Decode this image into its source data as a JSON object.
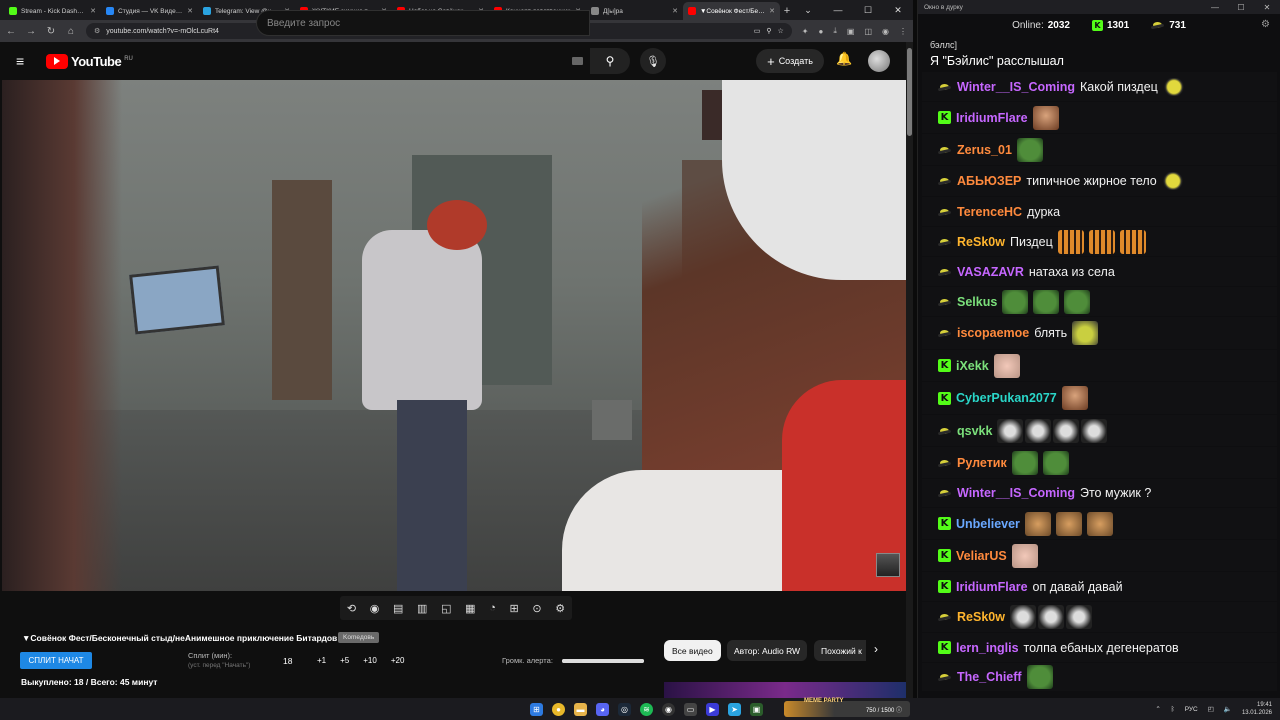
{
  "browser": {
    "tabs": [
      {
        "label": "Stream - Kick Dashboard",
        "color": "#53fc18"
      },
      {
        "label": "Студия — VK Видео Live",
        "color": "#2787f5"
      },
      {
        "label": "Telegram: View @union",
        "color": "#2aa3e0"
      },
      {
        "label": "ЖУТКИЕ зимние тради",
        "color": "#ff0000"
      },
      {
        "label": "Набег на Совёнок Фест",
        "color": "#ff0000"
      },
      {
        "label": "Концерт девственник",
        "color": "#ff0000"
      },
      {
        "label": "Д[ы]ра",
        "color": "#888888"
      },
      {
        "label": "▼Совёнок Фест/Беско",
        "color": "#ff0000"
      }
    ],
    "active_tab_index": 7,
    "url": "youtube.com/watch?v=-mOlcLcuRt4"
  },
  "youtube": {
    "logo_text": "YouTube",
    "logo_region": "RU",
    "search_placeholder": "Введите запрос",
    "create_label": "Создать"
  },
  "video": {
    "title": "▼Совёнок Фест/Бесконечный стыд/неАнимешное приключение Битардов",
    "category_badge": "Komeдoвь",
    "split_button": "СПЛИТ НАЧАТ",
    "split_label": "Сплит (мин):",
    "split_hint": "(уст. перед \"Начать\")",
    "split_value": "18",
    "split_steps": [
      "+1",
      "+5",
      "+10",
      "+20"
    ],
    "alert_volume_label": "Громк. алерта:",
    "alert_volume_level": 1.0,
    "bought_line": "Выкуплено: 18 / Всего: 45 минут",
    "chips": [
      "Все видео",
      "Автор: Audio RW",
      "Похожий к"
    ]
  },
  "chat": {
    "window_title": "Окно в дурку",
    "online_label": "Online:",
    "online_count": "2032",
    "kick_count": "1301",
    "vk_count": "731",
    "pre_lines": [
      "бэллс]",
      "Я \"Бэйлис\" расслышал"
    ],
    "messages": [
      {
        "platform": "owl",
        "user": "Winter__IS_Coming",
        "color": "#c667ff",
        "text": "Какой пиздец",
        "emotes": [
          "owl"
        ]
      },
      {
        "platform": "kick",
        "user": "IridiumFlare",
        "color": "#c667ff",
        "text": "",
        "emotes": [
          "face"
        ]
      },
      {
        "platform": "owl",
        "user": "Zerus_01",
        "color": "#ff8a3d",
        "text": "",
        "emotes": [
          "frog"
        ]
      },
      {
        "platform": "owl",
        "user": "АБЬЮЗЕР",
        "color": "#ff8a3d",
        "text": "типичное жирное тело",
        "emotes": [
          "owl"
        ]
      },
      {
        "platform": "owl",
        "user": "TerenceHC",
        "color": "#ff8a3d",
        "text": "дурка",
        "emotes": []
      },
      {
        "platform": "owl",
        "user": "ReSk0w",
        "color": "#ffb52e",
        "text": "Пиздец",
        "emotes": [
          "tiger",
          "tiger",
          "tiger"
        ]
      },
      {
        "platform": "owl",
        "user": "VASAZAVR",
        "color": "#c667ff",
        "text": "натаха из села",
        "emotes": []
      },
      {
        "platform": "owl",
        "user": "Selkus",
        "color": "#7be07b",
        "text": "",
        "emotes": [
          "frog",
          "frog",
          "frog"
        ]
      },
      {
        "platform": "owl",
        "user": "iscopaemoe",
        "color": "#ff8a3d",
        "text": "блять",
        "emotes": [
          "pepe"
        ]
      },
      {
        "platform": "kick",
        "user": "iXekk",
        "color": "#7be07b",
        "text": "",
        "emotes": [
          "cat"
        ]
      },
      {
        "platform": "kick",
        "user": "CyberPukan2077",
        "color": "#2ad6c8",
        "text": "",
        "emotes": [
          "face"
        ]
      },
      {
        "platform": "owl",
        "user": "qsvkk",
        "color": "#7be07b",
        "text": "",
        "emotes": [
          "skull",
          "skull",
          "skull",
          "skull"
        ]
      },
      {
        "platform": "owl",
        "user": "Рулетик",
        "color": "#ff8a3d",
        "text": "",
        "emotes": [
          "frog",
          "frog"
        ]
      },
      {
        "platform": "owl",
        "user": "Winter__IS_Coming",
        "color": "#c667ff",
        "text": "Это мужик ?",
        "emotes": []
      },
      {
        "platform": "kick",
        "user": "Unbeliever",
        "color": "#6aa8ff",
        "text": "",
        "emotes": [
          "lynx",
          "lynx",
          "lynx"
        ]
      },
      {
        "platform": "kick",
        "user": "VeliarUS",
        "color": "#ff8a3d",
        "text": "",
        "emotes": [
          "cat"
        ]
      },
      {
        "platform": "kick",
        "user": "IridiumFlare",
        "color": "#c667ff",
        "text": "оп давай давай",
        "emotes": []
      },
      {
        "platform": "owl",
        "user": "ReSk0w",
        "color": "#ffb52e",
        "text": "",
        "emotes": [
          "skull",
          "skull",
          "skull"
        ]
      },
      {
        "platform": "kick",
        "user": "lern_inglis",
        "color": "#c667ff",
        "text": "толпа ебаных дегенератов",
        "emotes": []
      },
      {
        "platform": "owl",
        "user": "The_Chieff",
        "color": "#c667ff",
        "text": "",
        "emotes": [
          "frog"
        ]
      }
    ]
  },
  "taskbar": {
    "widget_brand": "MEME PARTY",
    "widget_progress": "750 / 1500 ⓘ",
    "language": "РУС",
    "time": "19:41",
    "date": "13.01.2026"
  }
}
